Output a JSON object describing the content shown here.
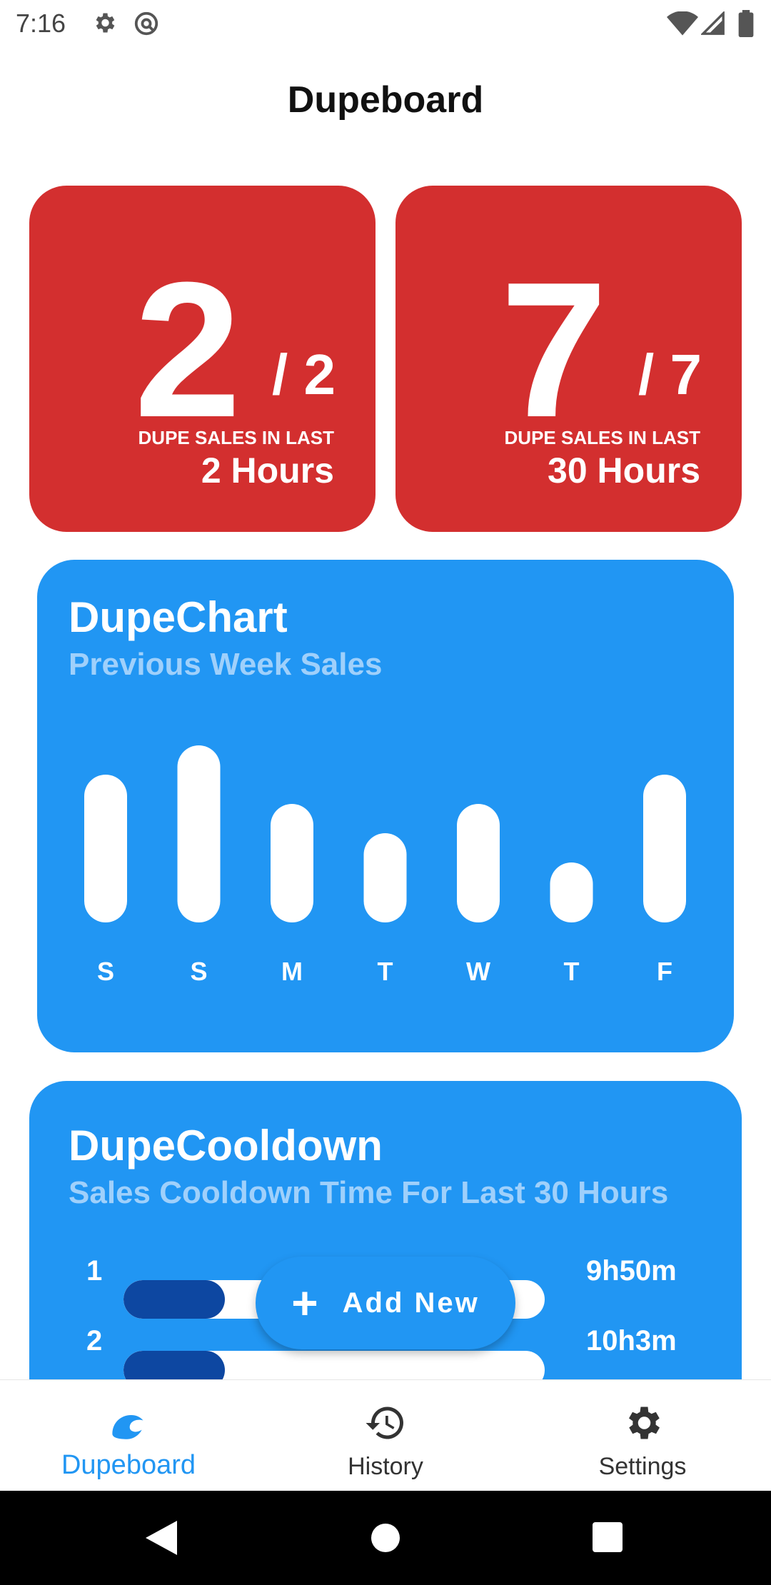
{
  "status_bar": {
    "time": "7:16"
  },
  "app": {
    "title": "Dupeboard"
  },
  "counters": [
    {
      "count": "2",
      "total": "/ 2",
      "caption": "DUPE SALES IN LAST",
      "window": "2 Hours"
    },
    {
      "count": "7",
      "total": "/ 7",
      "caption": "DUPE SALES IN LAST",
      "window": "30 Hours"
    }
  ],
  "dupechart": {
    "title": "DupeChart",
    "subtitle": "Previous Week Sales"
  },
  "chart_data": {
    "type": "bar",
    "categories": [
      "S",
      "S",
      "M",
      "T",
      "W",
      "T",
      "F"
    ],
    "values": [
      3,
      4,
      2,
      1,
      2,
      0,
      3
    ],
    "ylim": [
      0,
      4
    ],
    "bar_color": "#ffffff",
    "background": "#2196f3"
  },
  "dupecooldown": {
    "title": "DupeCooldown",
    "subtitle": "Sales Cooldown Time For Last 30 Hours",
    "rows": [
      {
        "index": "1",
        "time": "9h50m",
        "fill": 0.24
      },
      {
        "index": "2",
        "time": "10h3m",
        "fill": 0.24
      }
    ]
  },
  "fab": {
    "label": "Add New"
  },
  "bottom_nav": {
    "items": [
      {
        "label": "Dupeboard",
        "icon": "dupeboard-wave-icon",
        "active": true
      },
      {
        "label": "History",
        "icon": "history-icon",
        "active": false
      },
      {
        "label": "Settings",
        "icon": "settings-gear-icon",
        "active": false
      }
    ]
  },
  "colors": {
    "red": "#d32f2f",
    "blue": "#2196f3",
    "dark_blue": "#0d47a1",
    "subtitle": "#9fd0fb"
  }
}
